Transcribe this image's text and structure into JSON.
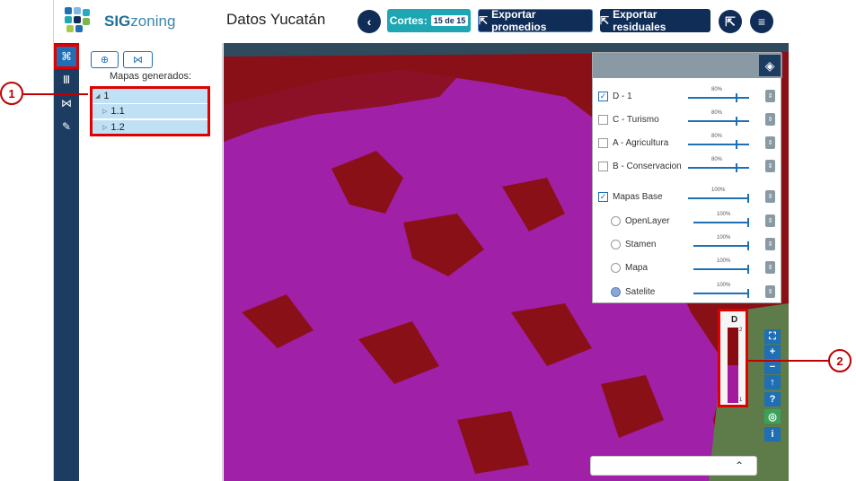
{
  "header": {
    "brand_bold": "SIG",
    "brand_rest": "zoning",
    "title": "Datos Yucatán",
    "cortes_label": "Cortes:",
    "cortes_badge": "15 de 15",
    "export_promedios": "Exportar promedios",
    "export_residuales": "Exportar residuales"
  },
  "toolbar": {
    "icons": [
      "map-frame-icon",
      "columns-icon",
      "network-icon",
      "brush-icon"
    ]
  },
  "panel": {
    "title": "Mapas generados:",
    "tree": [
      {
        "label": "1",
        "expanded": true
      },
      {
        "label": "1.1"
      },
      {
        "label": "1.2"
      }
    ]
  },
  "layers": {
    "items": [
      {
        "label": "D - 1",
        "checked": true,
        "opacity": "80%"
      },
      {
        "label": "C - Turismo",
        "checked": false,
        "opacity": "80%"
      },
      {
        "label": "A - Agricultura",
        "checked": false,
        "opacity": "80%"
      },
      {
        "label": "B - Conservacion",
        "checked": false,
        "opacity": "80%"
      },
      {
        "label": "Mapas Base",
        "checked": true,
        "opacity": "100%"
      },
      {
        "label": "OpenLayer",
        "radio": true,
        "selected": false,
        "opacity": "100%"
      },
      {
        "label": "Stamen",
        "radio": true,
        "selected": false,
        "opacity": "100%"
      },
      {
        "label": "Mapa",
        "radio": true,
        "selected": false,
        "opacity": "100%"
      },
      {
        "label": "Satelite",
        "radio": true,
        "selected": true,
        "opacity": "100%"
      }
    ]
  },
  "legend": {
    "title": "D",
    "max": "2",
    "min": "1",
    "colors": {
      "high": "#8a0a12",
      "low": "#a41a9e"
    }
  },
  "annotations": {
    "one": "1",
    "two": "2"
  },
  "colors": {
    "navy": "#0f2d57",
    "teal": "#1fa6b3",
    "toolbar": "#1c3d61",
    "map_red": "#8a1018",
    "map_magenta": "#a020a8",
    "annotation_red": "#e00000"
  }
}
